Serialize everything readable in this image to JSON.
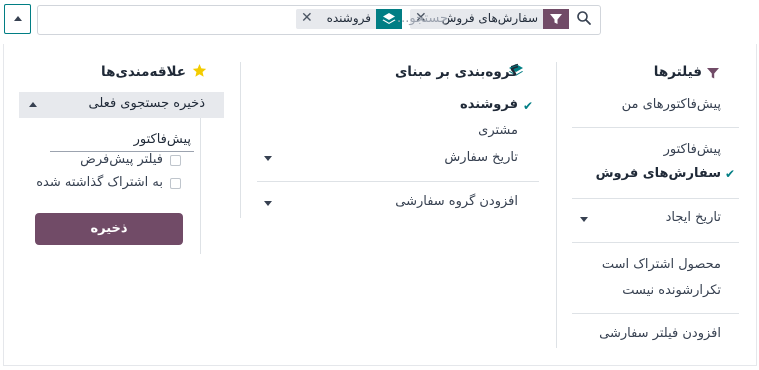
{
  "search": {
    "placeholder": "جستجو...",
    "facets": [
      {
        "label": "سفارش‌های فروش",
        "type": "filter"
      },
      {
        "label": "فروشنده",
        "type": "groupby"
      }
    ]
  },
  "filters": {
    "title": "فیلترها",
    "items": {
      "my_quotations": "پیش‌فاکتورهای من",
      "quotations": "پیش‌فاکتور",
      "sales_orders": "سفارش‌های فروش",
      "create_date": "تاریخ ایجاد",
      "subscription_product": "محصول اشتراک است",
      "non_recurring": "تکرارشونده نیست",
      "add_custom": "افزودن فیلتر سفارشی"
    }
  },
  "groupby": {
    "title": "گروه‌بندی بر مبنای",
    "items": {
      "salesperson": "فروشنده",
      "customer": "مشتری",
      "order_date": "تاریخ سفارش",
      "add_custom": "افزودن گروه سفارشی"
    }
  },
  "favorites": {
    "title": "علاقه‌مندی‌ها",
    "save_current": "ذخیره جستجوی فعلی",
    "name_value": "پیش‌فاکتور",
    "default_filter": "فیلتر پیش‌فرض",
    "shared": "به اشتراک گذاشته شده",
    "save_button": "ذخیره"
  },
  "colors": {
    "primary": "#714b67",
    "teal": "#017e84",
    "star": "#f3cc00"
  }
}
